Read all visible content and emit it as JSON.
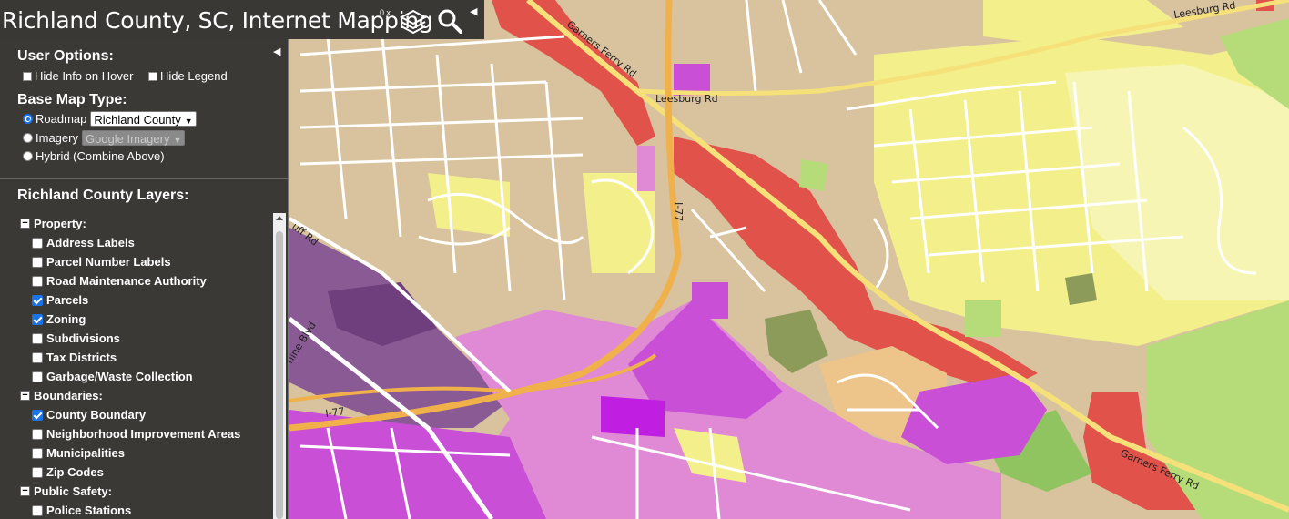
{
  "title": "Richland County, SC, Internet Mapping",
  "version": "0.x",
  "toolbar": {
    "layers_icon": "layers-icon",
    "search_icon": "search-icon",
    "collapse_icon": "collapse-left-icon"
  },
  "user_options": {
    "heading": "User Options:",
    "hide_info_on_hover": {
      "label": "Hide Info on Hover",
      "checked": false
    },
    "hide_legend": {
      "label": "Hide Legend",
      "checked": false
    }
  },
  "base_map": {
    "heading": "Base Map Type:",
    "roadmap": {
      "label": "Roadmap",
      "selected": true,
      "select_value": "Richland County"
    },
    "imagery": {
      "label": "Imagery",
      "selected": false,
      "select_value": "Google Imagery"
    },
    "hybrid": {
      "label": "Hybrid (Combine Above)",
      "selected": false
    }
  },
  "layers": {
    "heading": "Richland County Layers:",
    "groups": [
      {
        "label": "Property:",
        "items": [
          {
            "label": "Address Labels",
            "checked": false
          },
          {
            "label": "Parcel Number Labels",
            "checked": false
          },
          {
            "label": "Road Maintenance Authority",
            "checked": false
          },
          {
            "label": "Parcels",
            "checked": true
          },
          {
            "label": "Zoning",
            "checked": true
          },
          {
            "label": "Subdivisions",
            "checked": false
          },
          {
            "label": "Tax Districts",
            "checked": false
          },
          {
            "label": "Garbage/Waste Collection",
            "checked": false
          }
        ]
      },
      {
        "label": "Boundaries:",
        "items": [
          {
            "label": "County Boundary",
            "checked": true
          },
          {
            "label": "Neighborhood Improvement Areas",
            "checked": false
          },
          {
            "label": "Municipalities",
            "checked": false
          },
          {
            "label": "Zip Codes",
            "checked": false
          }
        ]
      },
      {
        "label": "Public Safety:",
        "items": [
          {
            "label": "Police Stations",
            "checked": false
          }
        ]
      }
    ]
  },
  "map_labels": {
    "garners_ferry_nw": "Garners Ferry Rd",
    "leesburg_mid": "Leesburg Rd",
    "leesburg_ne": "Leesburg Rd",
    "i77_vertical": "I-77",
    "i77_lower": "I-77",
    "bluff_blvd": "uff Rd",
    "shine_blvd": "hine Blvd",
    "garners_ferry_se": "Garners Ferry Rd"
  },
  "colors": {
    "residential_beige": "#d8c39e",
    "residential_yellow": "#f3f08c",
    "light_yellow": "#f7f5b4",
    "commercial_red": "#e0524a",
    "industrial_purple": "#8a5a94",
    "light_industrial_pink": "#e08ad6",
    "magenta": "#c84fd6",
    "green": "#b6dc7a",
    "olive": "#8c9a5a",
    "tan_orange": "#edc48a",
    "highway_orange": "#f0b04a",
    "panel_bg": "#303030"
  }
}
